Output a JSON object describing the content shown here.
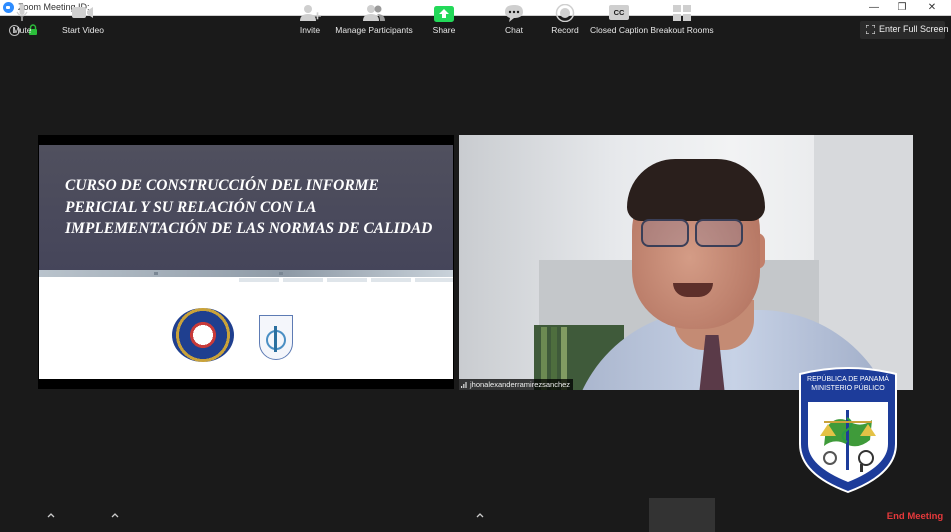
{
  "window": {
    "title": "Zoom Meeting ID:",
    "minimize": "—",
    "restore": "❐",
    "close": "✕"
  },
  "topbar": {
    "info_glyph": "i",
    "fullscreen_label": "Enter Full Screen"
  },
  "slide": {
    "title": "CURSO DE CONSTRUCCIÓN DEL INFORME PERICIAL Y SU RELACIÓN CON LA IMPLEMENTACIÓN DE LAS NORMAS DE CALIDAD"
  },
  "participant": {
    "name": "jhonalexanderramirezsanchez"
  },
  "logo": {
    "line1": "REPÚBLICA DE PANAMÁ",
    "line2": "MINISTERIO PÚBLICO",
    "arc_text": "INSTITUTO DE MEDICINA LEGAL Y CIENCIAS FORENSES"
  },
  "toolbar": {
    "mute": "Mute",
    "start_video": "Start Video",
    "invite": "Invite",
    "manage_participants": "Manage Participants",
    "share": "Share",
    "chat": "Chat",
    "record": "Record",
    "closed_caption": "Closed Caption",
    "cc_glyph": "CC",
    "breakout_rooms": "Breakout Rooms",
    "end_meeting": "End Meeting"
  },
  "colors": {
    "share_green": "#23d959",
    "end_red": "#e5393b",
    "zoom_blue": "#2d8cff",
    "lock_green": "#2bbf3a"
  },
  "icons": [
    "info-icon",
    "lock-icon",
    "fullscreen-icon",
    "microphone-icon",
    "video-camera-icon",
    "invite-icon",
    "participants-icon",
    "share-arrow-icon",
    "chat-bubble-icon",
    "record-icon",
    "cc-icon",
    "breakout-grid-icon",
    "caret-up-icon"
  ]
}
